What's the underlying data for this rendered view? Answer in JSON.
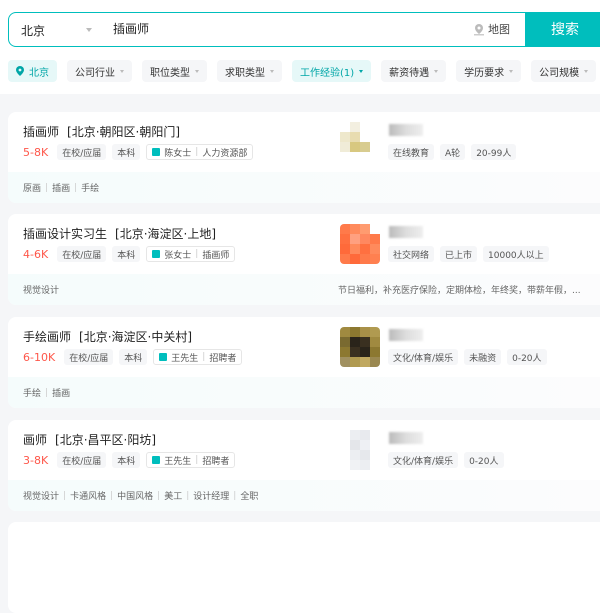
{
  "search": {
    "city": "北京",
    "query": "插画师",
    "map_label": "地图",
    "button": "搜索"
  },
  "filters": [
    {
      "label": "北京",
      "active": true,
      "icon": "location-pin-icon"
    },
    {
      "label": "公司行业"
    },
    {
      "label": "职位类型"
    },
    {
      "label": "求职类型"
    },
    {
      "label": "工作经验(1)",
      "active": true
    },
    {
      "label": "薪资待遇"
    },
    {
      "label": "学历要求"
    },
    {
      "label": "公司规模"
    }
  ],
  "accent": "#00bebd",
  "salary_color": "#fe574a",
  "jobs": [
    {
      "title": "插画师",
      "location": "[北京·朝阳区·朝阳门]",
      "salary": "5-8K",
      "tags": [
        "在校/应届",
        "本科"
      ],
      "recruiter": "陈女士",
      "recruiter_title": "人力资源部",
      "company_tags": [
        "在线教育",
        "A轮",
        "20-99人"
      ],
      "skills": [
        "原画",
        "插画",
        "手绘"
      ],
      "welfare": ""
    },
    {
      "title": "插画设计实习生",
      "location": "[北京·海淀区·上地]",
      "salary": "4-6K",
      "tags": [
        "在校/应届",
        "本科"
      ],
      "recruiter": "张女士",
      "recruiter_title": "插画师",
      "company_tags": [
        "社交网络",
        "已上市",
        "10000人以上"
      ],
      "skills": [
        "视觉设计"
      ],
      "welfare": "节日福利，补充医疗保险，定期体检，年终奖，带薪年假，..."
    },
    {
      "title": "手绘画师",
      "location": "[北京·海淀区·中关村]",
      "salary": "6-10K",
      "tags": [
        "在校/应届",
        "本科"
      ],
      "recruiter": "王先生",
      "recruiter_title": "招聘者",
      "company_tags": [
        "文化/体育/娱乐",
        "未融资",
        "0-20人"
      ],
      "skills": [
        "手绘",
        "插画"
      ],
      "welfare": ""
    },
    {
      "title": "画师",
      "location": "[北京·昌平区·阳坊]",
      "salary": "3-8K",
      "tags": [
        "在校/应届",
        "本科"
      ],
      "recruiter": "王先生",
      "recruiter_title": "招聘者",
      "company_tags": [
        "文化/体育/娱乐",
        "0-20人"
      ],
      "skills": [
        "视觉设计",
        "卡通风格",
        "中国风格",
        "美工",
        "设计经理",
        "全职"
      ],
      "welfare": ""
    }
  ]
}
